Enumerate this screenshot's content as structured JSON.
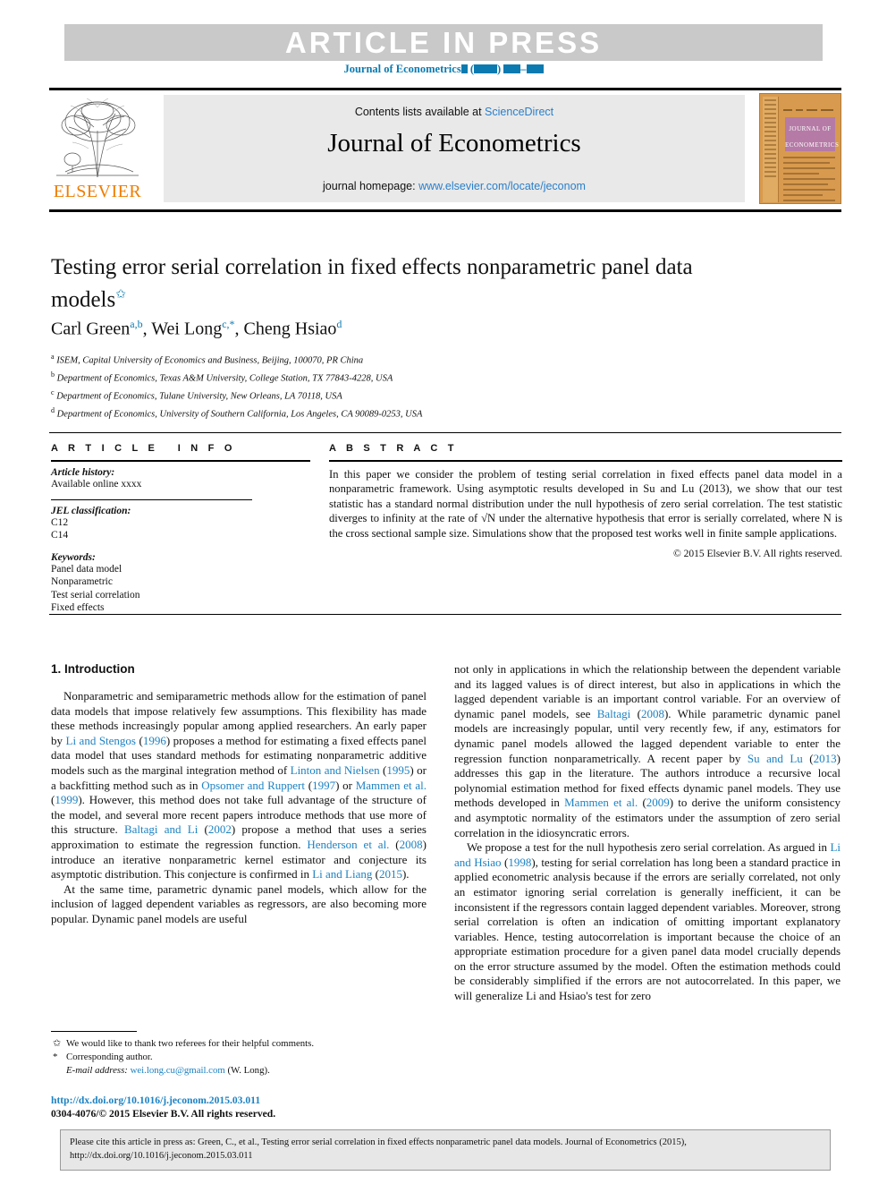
{
  "banner": {
    "article_in_press": "ARTICLE IN PRESS",
    "running_head_prefix": "Journal of Econometrics"
  },
  "masthead": {
    "contents_prefix": "Contents lists available at ",
    "sciencedirect": "ScienceDirect",
    "journal_name": "Journal of Econometrics",
    "homepage_label": "journal homepage: ",
    "homepage_url": "www.elsevier.com/locate/jeconom",
    "publisher": "ELSEVIER",
    "cover_title_line1": "JOURNAL OF",
    "cover_title_line2": "ECONOMETRICS"
  },
  "article": {
    "title": "Testing error serial correlation in fixed effects nonparametric panel data models",
    "title_footnote_mark": "✩",
    "authors_html": "Carl Green<sup>a,b</sup>, Wei Long<sup>c,*</sup>, Cheng Hsiao<sup>d</sup>",
    "affiliations": [
      {
        "mark": "a",
        "text": "ISEM, Capital University of Economics and Business, Beijing, 100070, PR China"
      },
      {
        "mark": "b",
        "text": "Department of Economics, Texas A&M University, College Station, TX 77843-4228, USA"
      },
      {
        "mark": "c",
        "text": "Department of Economics, Tulane University, New Orleans, LA 70118, USA"
      },
      {
        "mark": "d",
        "text": "Department of Economics, University of Southern California, Los Angeles, CA 90089-0253, USA"
      }
    ]
  },
  "article_info": {
    "heading": "ARTICLE INFO",
    "history_label": "Article history:",
    "history_value": "Available online xxxx",
    "jel_label": "JEL classification:",
    "jel_codes": [
      "C12",
      "C14"
    ],
    "keywords_label": "Keywords:",
    "keywords": [
      "Panel data model",
      "Nonparametric",
      "Test serial correlation",
      "Fixed effects"
    ]
  },
  "abstract": {
    "heading": "ABSTRACT",
    "part1": "In this paper we consider the problem of testing serial correlation in fixed effects panel data model in a nonparametric framework. Using asymptotic results developed in Su and Lu (2013), we show that our test statistic has a standard normal distribution under the null hypothesis of zero serial correlation. The test statistic diverges to infinity at the rate of ",
    "radical": "√N",
    "part2": " under the alternative hypothesis that error is serially correlated, where N is the cross sectional sample size. Simulations show that the proposed test works well in finite sample applications.",
    "copyright": "© 2015 Elsevier B.V. All rights reserved."
  },
  "body": {
    "section_heading": "1. Introduction",
    "left": {
      "p1_a": "Nonparametric and semiparametric methods allow for the estimation of panel data models that impose relatively few assumptions. This flexibility has made these methods increasingly popular among applied researchers. An early paper by ",
      "cite_li_stengos": "Li and Stengos",
      "p1_b": " (",
      "year_1996": "1996",
      "p1_c": ") proposes a method for estimating a fixed effects panel data model that uses standard methods for estimating nonparametric additive models such as the marginal integration method of ",
      "cite_linton_nielsen": "Linton and Nielsen",
      "p1_d": " (",
      "year_1995": "1995",
      "p1_e": ") or a backfitting method such as in ",
      "cite_opsomer_ruppert": "Opsomer and Ruppert",
      "p1_f": " (",
      "year_1997": "1997",
      "p1_g": ") or ",
      "cite_mammen_1999": "Mammen et al.",
      "p1_h": " (",
      "year_1999": "1999",
      "p1_i": "). However, this method does not take full advantage of the structure of the model, and several more recent papers introduce methods that use more of this structure. ",
      "cite_baltagi_li": "Baltagi and Li",
      "p1_j": " (",
      "year_2002": "2002",
      "p1_k": ") propose a method that uses a series approximation to estimate the regression function. ",
      "cite_henderson": "Henderson et al.",
      "p1_l": " (",
      "year_2008b": "2008",
      "p1_m": ") introduce an iterative nonparametric kernel estimator and conjecture its asymptotic distribution. This conjecture is confirmed in ",
      "cite_li_liang": "Li and Liang",
      "p1_n": " (",
      "year_2015": "2015",
      "p1_o": ").",
      "p2": "At the same time, parametric dynamic panel models, which allow for the inclusion of lagged dependent variables as regressors, are also becoming more popular. Dynamic panel models are useful"
    },
    "right": {
      "p1_a": "not only in applications in which the relationship between the dependent variable and its lagged values is of direct interest, but also in applications in which the lagged dependent variable is an important control variable. For an overview of dynamic panel models, see ",
      "cite_baltagi": "Baltagi",
      "p1_b": " (",
      "year_2008": "2008",
      "p1_c": "). While parametric dynamic panel models are increasingly popular, until very recently few, if any, estimators for dynamic panel models allowed the lagged dependent variable to enter the regression function nonparametrically. A recent paper by ",
      "cite_su_lu": "Su and Lu",
      "p1_d": " (",
      "year_2013": "2013",
      "p1_e": ") addresses this gap in the literature. The authors introduce a recursive local polynomial estimation method for fixed effects dynamic panel models. They use methods developed in ",
      "cite_mammen_2009": "Mammen et al.",
      "p1_f": " (",
      "year_2009": "2009",
      "p1_g": ") to derive the uniform consistency and asymptotic normality of the estimators under the assumption of zero serial correlation in the idiosyncratic errors.",
      "p2_a": "We propose a test for the null hypothesis zero serial correlation. As argued in ",
      "cite_li_hsiao": "Li and Hsiao",
      "p2_b": " (",
      "year_1998": "1998",
      "p2_c": "), testing for serial correlation has long been a standard practice in applied econometric analysis because if the errors are serially correlated, not only an estimator ignoring serial correlation is generally inefficient, it can be inconsistent if the regressors contain lagged dependent variables. Moreover, strong serial correlation is often an indication of omitting important explanatory variables. Hence, testing autocorrelation is important because the choice of an appropriate estimation procedure for a given panel data model crucially depends on the error structure assumed by the model. Often the estimation methods could be considerably simplified if the errors are not autocorrelated. In this paper, we will generalize Li and Hsiao's test for zero"
    }
  },
  "footnotes": {
    "star_mark": "✩",
    "star_text": "We would like to thank two referees for their helpful comments.",
    "asterisk_mark": "*",
    "asterisk_text": "Corresponding author.",
    "email_label": "E-mail address:",
    "email": "wei.long.cu@gmail.com",
    "email_suffix": "(W. Long).",
    "doi_url": "http://dx.doi.org/10.1016/j.jeconom.2015.03.011",
    "issn_line": "0304-4076/© 2015 Elsevier B.V. All rights reserved."
  },
  "citation_footer": {
    "line1": "Please cite this article in press as: Green, C., et al., Testing error serial correlation in fixed effects nonparametric panel data models. Journal of Econometrics (2015),",
    "line2": "http://dx.doi.org/10.1016/j.jeconom.2015.03.011"
  },
  "colors": {
    "link": "#1d82c2",
    "banner_grey": "#c9c9c9",
    "elsevier_orange": "#ef7d00",
    "running_head": "#0b7ab0"
  }
}
